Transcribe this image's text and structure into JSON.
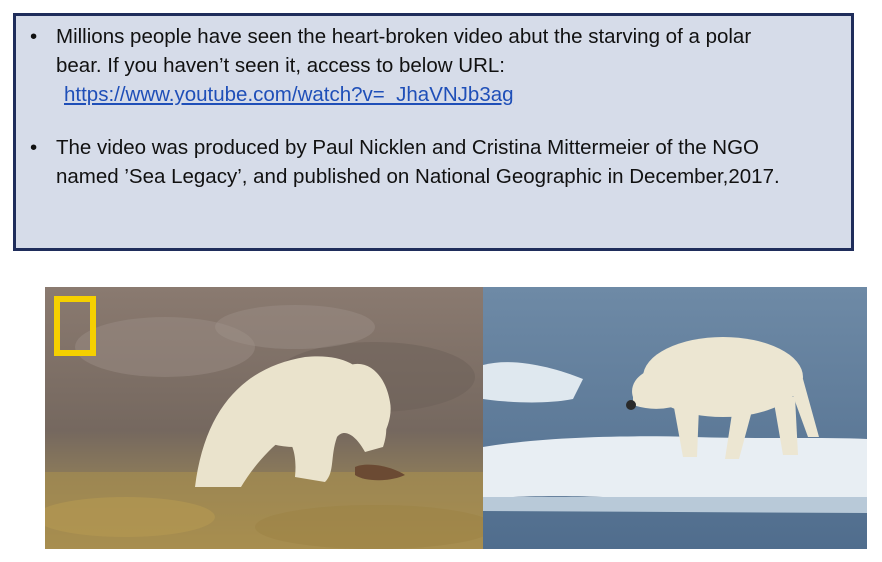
{
  "slide": {
    "bullets": [
      {
        "text_line1": "Millions people have seen the heart-broken video abut the starving of a polar",
        "text_line2": "bear. If you haven’t seen it, access to below URL:",
        "url": "https://www.youtube.com/watch?v=_JhaVNJb3ag"
      },
      {
        "text_line1": "The video was produced by Paul Nicklen and Cristina Mittermeier of the NGO",
        "text_line2": "named ’Sea Legacy’, and published on National Geographic in December,2017."
      }
    ],
    "bullet_symbol": "•"
  },
  "images": [
    {
      "name": "polar-bear-on-tundra-photo",
      "logo": "national-geographic-logo"
    },
    {
      "name": "polar-bear-on-ice-floe-photo"
    }
  ],
  "colors": {
    "box_fill": "#d6dce9",
    "box_border": "#1f2d5b",
    "link": "#1f4fb8",
    "natgeo_yellow": "#f5d000"
  }
}
